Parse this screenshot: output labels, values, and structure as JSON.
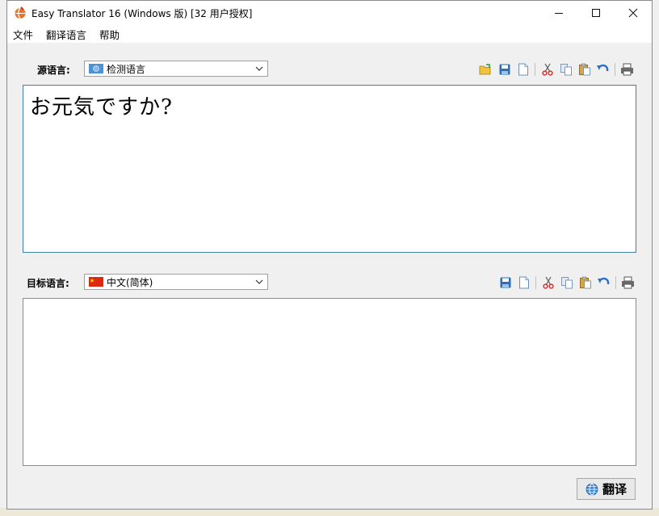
{
  "window": {
    "title": "Easy Translator 16 (Windows 版) [32 用户授权]",
    "controls": {
      "minimize": "—",
      "maximize": "☐",
      "close": "✕"
    }
  },
  "menu": [
    "文件",
    "翻译语言",
    "帮助"
  ],
  "source": {
    "label": "源语言:",
    "language": "检测语言",
    "text": "お元気ですか?",
    "toolbar": [
      "open-folder-icon",
      "save-icon",
      "new-document-icon",
      "cut-icon",
      "copy-icon",
      "paste-icon",
      "undo-icon",
      "print-icon"
    ]
  },
  "target": {
    "label": "目标语言:",
    "language": "中文(简体)",
    "text": "",
    "toolbar": [
      "save-icon",
      "new-document-icon",
      "cut-icon",
      "copy-icon",
      "paste-icon",
      "undo-icon",
      "print-icon"
    ]
  },
  "translate_button": "翻译",
  "colors": {
    "focus_border": "#3c7fb1",
    "window_bg": "#f0f0f0",
    "accent_blue": "#2a6fc9"
  }
}
